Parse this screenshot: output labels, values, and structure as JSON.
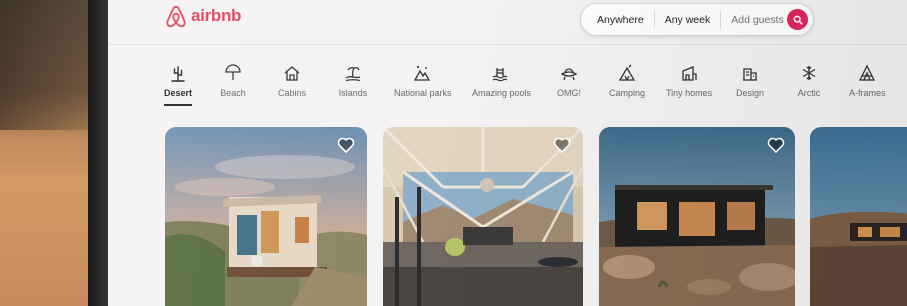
{
  "brand": {
    "name": "airbnb",
    "color": "#e0445e"
  },
  "search": {
    "where": "Anywhere",
    "when": "Any week",
    "guests": "Add guests",
    "button_icon": "search-icon",
    "button_color": "#e0245e"
  },
  "categories": [
    {
      "label": "Desert",
      "icon": "cactus-icon",
      "active": true
    },
    {
      "label": "Beach",
      "icon": "umbrella-icon",
      "active": false
    },
    {
      "label": "Cabins",
      "icon": "cabin-icon",
      "active": false
    },
    {
      "label": "Islands",
      "icon": "island-icon",
      "active": false
    },
    {
      "label": "National parks",
      "icon": "mountain-icon",
      "active": false
    },
    {
      "label": "Amazing pools",
      "icon": "pool-icon",
      "active": false
    },
    {
      "label": "OMG!",
      "icon": "ufo-icon",
      "active": false
    },
    {
      "label": "Camping",
      "icon": "tent-icon",
      "active": false
    },
    {
      "label": "Tiny homes",
      "icon": "tiny-home-icon",
      "active": false
    },
    {
      "label": "Design",
      "icon": "design-building-icon",
      "active": false
    },
    {
      "label": "Arctic",
      "icon": "snowflake-icon",
      "active": false
    },
    {
      "label": "A-frames",
      "icon": "a-frame-icon",
      "active": false
    }
  ],
  "listings": [
    {
      "photo": "tiny cabin in desert at sunset",
      "wishlist_icon": "heart-icon"
    },
    {
      "photo": "modern geodesic interior with mountain view",
      "wishlist_icon": "heart-icon"
    },
    {
      "photo": "modern desert house at dusk",
      "wishlist_icon": "heart-icon"
    },
    {
      "photo": "desert landscape with house"
    }
  ]
}
